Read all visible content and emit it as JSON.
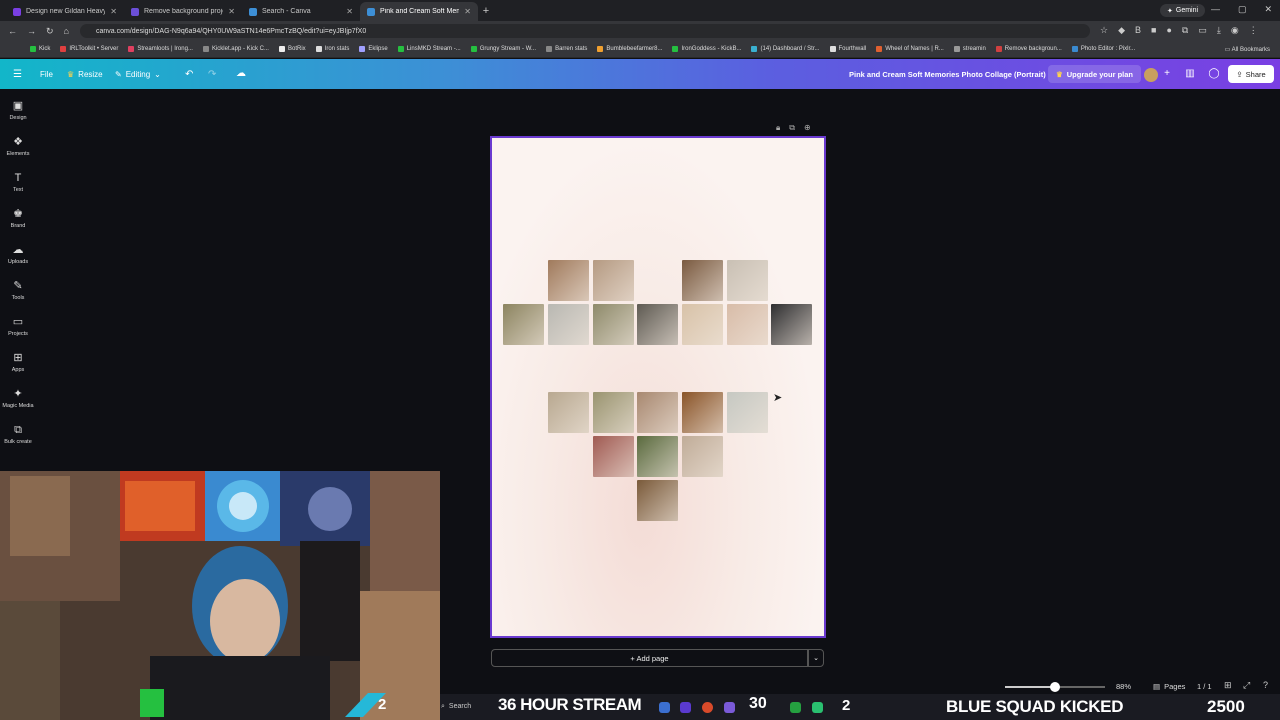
{
  "browser": {
    "tabs": [
      {
        "title": "Design new Gildan Heavyweig",
        "color": "#7a3fe3",
        "active": false
      },
      {
        "title": "Remove background project -",
        "color": "#6b4fd8",
        "active": false
      },
      {
        "title": "Search - Canva",
        "color": "#3d8fd6",
        "active": false
      },
      {
        "title": "Pink and Cream Soft Memorie",
        "color": "#3d8fd6",
        "active": true
      }
    ],
    "gemini_label": "Gemini",
    "url": "canva.com/design/DAG-N9q6a94/QHY0UW9aSTN14e6PmcTzBQ/edit?ui=eyJBIjp7fX0",
    "bookmarks": [
      "Kick",
      "IRLToolkit • Server",
      "Streamloots | Irong...",
      "Kicklet.app - Kick C...",
      "BotRix",
      "Iron stats",
      "Eklipse",
      "LinsMKD Stream -...",
      "Grungy Stream - W...",
      "Barren stats",
      "Bumblebeefarmer8...",
      "IronGoddess - KickB...",
      "(14) Dashboard / Str...",
      "Fourthwall",
      "Wheel of Names | R...",
      "streamin",
      "Remove backgroun...",
      "Photo Editor : Pixlr..."
    ],
    "all_bookmarks": "All Bookmarks"
  },
  "canva": {
    "toolbar": {
      "file": "File",
      "resize": "Resize",
      "editing": "Editing",
      "doc_title": "Pink and Cream Soft Memories Photo Collage (Portrait)",
      "upgrade": "Upgrade your plan",
      "share": "Share"
    },
    "sidebar": [
      {
        "label": "Design",
        "icon": "design-icon",
        "glyph": "▣"
      },
      {
        "label": "Elements",
        "icon": "elements-icon",
        "glyph": "❖"
      },
      {
        "label": "Text",
        "icon": "text-icon",
        "glyph": "T"
      },
      {
        "label": "Brand",
        "icon": "brand-icon",
        "glyph": "♚"
      },
      {
        "label": "Uploads",
        "icon": "uploads-icon",
        "glyph": "☁"
      },
      {
        "label": "Tools",
        "icon": "tools-icon",
        "glyph": "✎"
      },
      {
        "label": "Projects",
        "icon": "projects-icon",
        "glyph": "▭"
      },
      {
        "label": "Apps",
        "icon": "apps-icon",
        "glyph": "⊞"
      },
      {
        "label": "Magic Media",
        "icon": "magic-media-icon",
        "glyph": "✦"
      },
      {
        "label": "Bulk create",
        "icon": "bulk-create-icon",
        "glyph": "⧉"
      }
    ],
    "photos": [
      {
        "tone": "#a07a5c"
      },
      {
        "tone": "#b59a82"
      },
      {
        "tone": "#7a5a40"
      },
      {
        "tone": "#c9c0b4"
      },
      {
        "tone": "#8c8460"
      },
      {
        "tone": "#b9b8b2"
      },
      {
        "tone": "#8e8a6a"
      },
      {
        "tone": "#5e5a52"
      },
      {
        "tone": "#d8c2a8"
      },
      {
        "tone": "#d8bca8"
      },
      {
        "tone": "#2e2e30"
      },
      {
        "tone": "#b8a890"
      },
      {
        "tone": "#9a9470"
      },
      {
        "tone": "#a88870"
      },
      {
        "tone": "#8a5428"
      },
      {
        "tone": "#c6c8c2"
      },
      {
        "tone": "#a05a52"
      },
      {
        "tone": "#5a6a3e"
      },
      {
        "tone": "#c0ac98"
      },
      {
        "tone": "#7a5a3a"
      }
    ],
    "add_page": "+ Add page",
    "zoom": "88%",
    "zoom_fraction": 0.5,
    "pages_label": "Pages",
    "page_count": "1 / 1"
  },
  "overlay": {
    "search": "Search",
    "stream_text": "36 HOUR STREAM",
    "counter_a": "30",
    "counter_b": "2",
    "kicked_text": "BLUE SQUAD KICKED",
    "goal": "2500",
    "badge_number": "2"
  }
}
